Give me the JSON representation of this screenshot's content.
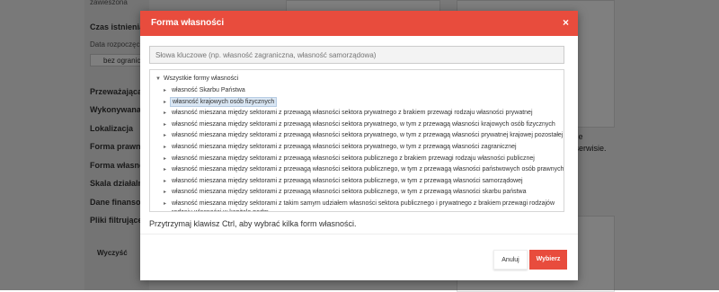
{
  "background": {
    "sidebar_items": [
      "Czas istnienia",
      "Przeważająca d",
      "Wykonywana d",
      "Lokalizacja",
      "Forma prawna",
      "Forma własnoś",
      "Skala działalno",
      "Dane finansowe",
      "Pliki filtrujące"
    ],
    "top_item": "zawieszona",
    "date_label": "Data rozpoczęci",
    "date_value": "bez ogranicz",
    "clear_label": "Wyczyść",
    "right_text_1": "i nie",
    "right_text_2": "n serwisie."
  },
  "modal": {
    "title": "Forma własności",
    "close_label": "×",
    "search_placeholder": "Słowa kluczowe (np. własność zagraniczna, własność samorządowa)",
    "tree": {
      "root_label": "Wszystkie formy własności",
      "items": [
        {
          "label": "własność Skarbu Państwa"
        },
        {
          "label": "własność krajowych osób fizycznych",
          "selected": true
        },
        {
          "label": "własność mieszana między sektorami z przewagą własności sektora prywatnego z brakiem przewagi rodzaju własności prywatnej"
        },
        {
          "label": "własność mieszana między sektorami z przewagą własności sektora prywatnego, w tym z przewagą własności krajowych osób fizycznych"
        },
        {
          "label": "własność mieszana między sektorami z przewagą własności sektora prywatnego, w tym z przewagą własności prywatnej krajowej pozostałej"
        },
        {
          "label": "własność mieszana między sektorami z przewagą własności sektora prywatnego, w tym z przewagą własności zagranicznej"
        },
        {
          "label": "własność mieszana między sektorami z przewagą własności sektora publicznego z brakiem przewagi rodzaju własności publicznej"
        },
        {
          "label": "własność mieszana między sektorami z przewagą własności sektora publicznego, w tym z przewagą własności państwowych osób prawnych"
        },
        {
          "label": "własność mieszana między sektorami z przewagą własności sektora publicznego, w tym z przewagą własności samorządowej"
        },
        {
          "label": "własność mieszana między sektorami z przewagą własności sektora publicznego, w tym z przewagą własności skarbu państwa"
        },
        {
          "label": "własność mieszana między sektorami z takim samym udziałem własności sektora publicznego i prywatnego z brakiem przewagi rodzajów",
          "label2": "rodzaju własności w kapitale podm"
        }
      ]
    },
    "hint": "Przytrzymaj klawisz Ctrl, aby wybrać kilka form własności.",
    "cancel_label": "Anuluj",
    "select_label": "Wybierz"
  }
}
